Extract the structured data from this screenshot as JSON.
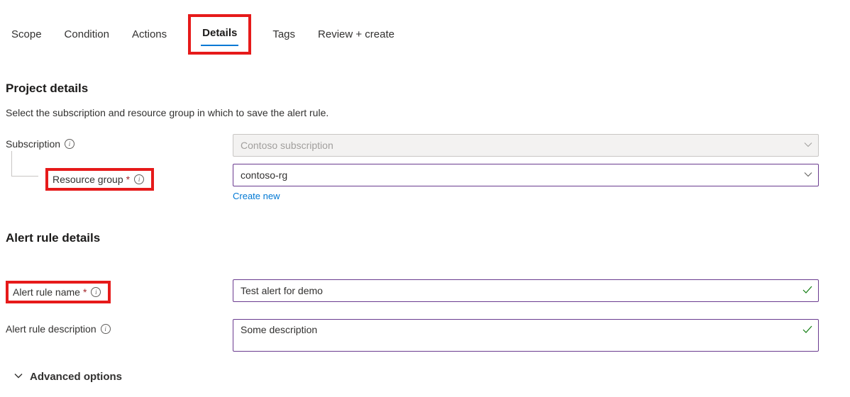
{
  "tabs": {
    "scope": "Scope",
    "condition": "Condition",
    "actions": "Actions",
    "details": "Details",
    "tags": "Tags",
    "review": "Review + create"
  },
  "project": {
    "heading": "Project details",
    "desc": "Select the subscription and resource group in which to save the alert rule.",
    "subscription_label": "Subscription",
    "subscription_value": "Contoso subscription",
    "resource_group_label": "Resource group",
    "resource_group_value": "contoso-rg",
    "create_new": "Create new"
  },
  "rule": {
    "heading": "Alert rule details",
    "name_label": "Alert rule name",
    "name_value": "Test alert for demo",
    "desc_label": "Alert rule description",
    "desc_value": "Some description"
  },
  "advanced": "Advanced options"
}
